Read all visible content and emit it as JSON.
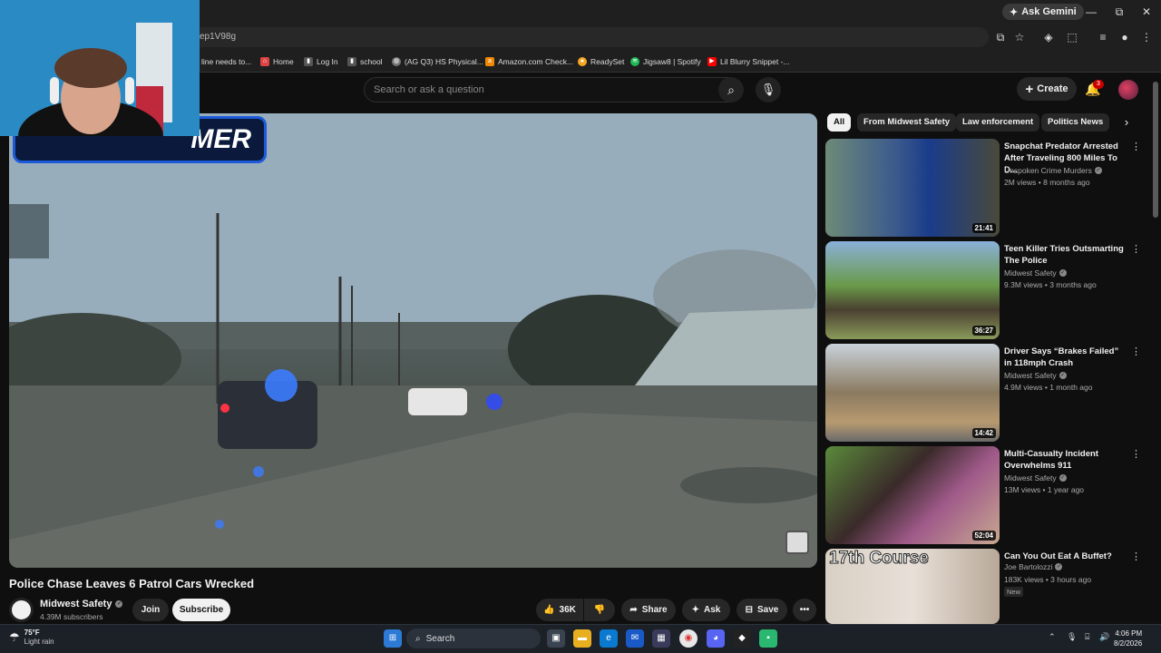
{
  "browser": {
    "gemini_label": "Ask Gemini",
    "url": "ep1V98g",
    "window_controls": {
      "minimize": "—",
      "maximize": "⧉",
      "close": "✕"
    },
    "bookmarks": [
      {
        "label": "line needs to...",
        "icon": "page-icon"
      },
      {
        "label": "Home",
        "icon": "home-icon",
        "color": "#d44"
      },
      {
        "label": "Log In",
        "icon": "login-icon",
        "color": "#fff"
      },
      {
        "label": "school",
        "icon": "school-icon",
        "color": "#fff"
      },
      {
        "label": "(AG Q3) HS Physical...",
        "icon": "globe-icon",
        "color": "#aaa"
      },
      {
        "label": "Amazon.com Check...",
        "icon": "amazon-icon",
        "color": "#f08804"
      },
      {
        "label": "ReadySet",
        "icon": "readyset-icon",
        "color": "#f5a623"
      },
      {
        "label": "Jigsaw8 | Spotify",
        "icon": "spotify-icon",
        "color": "#1db954"
      },
      {
        "label": "Lil Blurry Snippet -...",
        "icon": "youtube-icon",
        "color": "#f00"
      }
    ]
  },
  "header": {
    "search_placeholder": "Search or ask a question",
    "create_label": "Create",
    "notification_count": "3"
  },
  "video": {
    "overlay_text": "MER",
    "title": "Police Chase Leaves 6 Patrol Cars Wrecked",
    "channel": "Midwest Safety",
    "subscribers": "4.39M subscribers",
    "join_label": "Join",
    "subscribe_label": "Subscribe",
    "likes": "36K",
    "share_label": "Share",
    "ask_label": "Ask",
    "save_label": "Save"
  },
  "chips": [
    {
      "label": "All",
      "active": true
    },
    {
      "label": "From Midwest Safety",
      "active": false
    },
    {
      "label": "Law enforcement",
      "active": false
    },
    {
      "label": "Politics News",
      "active": false
    }
  ],
  "recommendations": [
    {
      "title": "Snapchat Predator Arrested After Traveling 800 Miles To D...",
      "channel": "Unspoken Crime Murders",
      "meta": "2M views • 8 months ago",
      "duration": "21:41",
      "new": false
    },
    {
      "title": "Teen Killer Tries Outsmarting The Police",
      "channel": "Midwest Safety",
      "meta": "9.3M views • 3 months ago",
      "duration": "36:27",
      "new": false
    },
    {
      "title": "Driver Says “Brakes Failed” in 118mph Crash",
      "channel": "Midwest Safety",
      "meta": "4.9M views • 1 month ago",
      "duration": "14:42",
      "new": false
    },
    {
      "title": "Multi-Casualty Incident Overwhelms 911",
      "channel": "Midwest Safety",
      "meta": "13M views • 1 year ago",
      "duration": "52:04",
      "new": false
    },
    {
      "title": "Can You Out Eat A Buffet?",
      "channel": "Joe Bartolozzi",
      "meta": "183K views • 3 hours ago",
      "duration": "",
      "new": true,
      "new_label": "New",
      "thumb_text": "17th Course"
    }
  ],
  "taskbar": {
    "temperature": "75°F",
    "weather": "Light rain",
    "search_label": "Search",
    "time": "4:06 PM",
    "date": "8/2/2026"
  }
}
